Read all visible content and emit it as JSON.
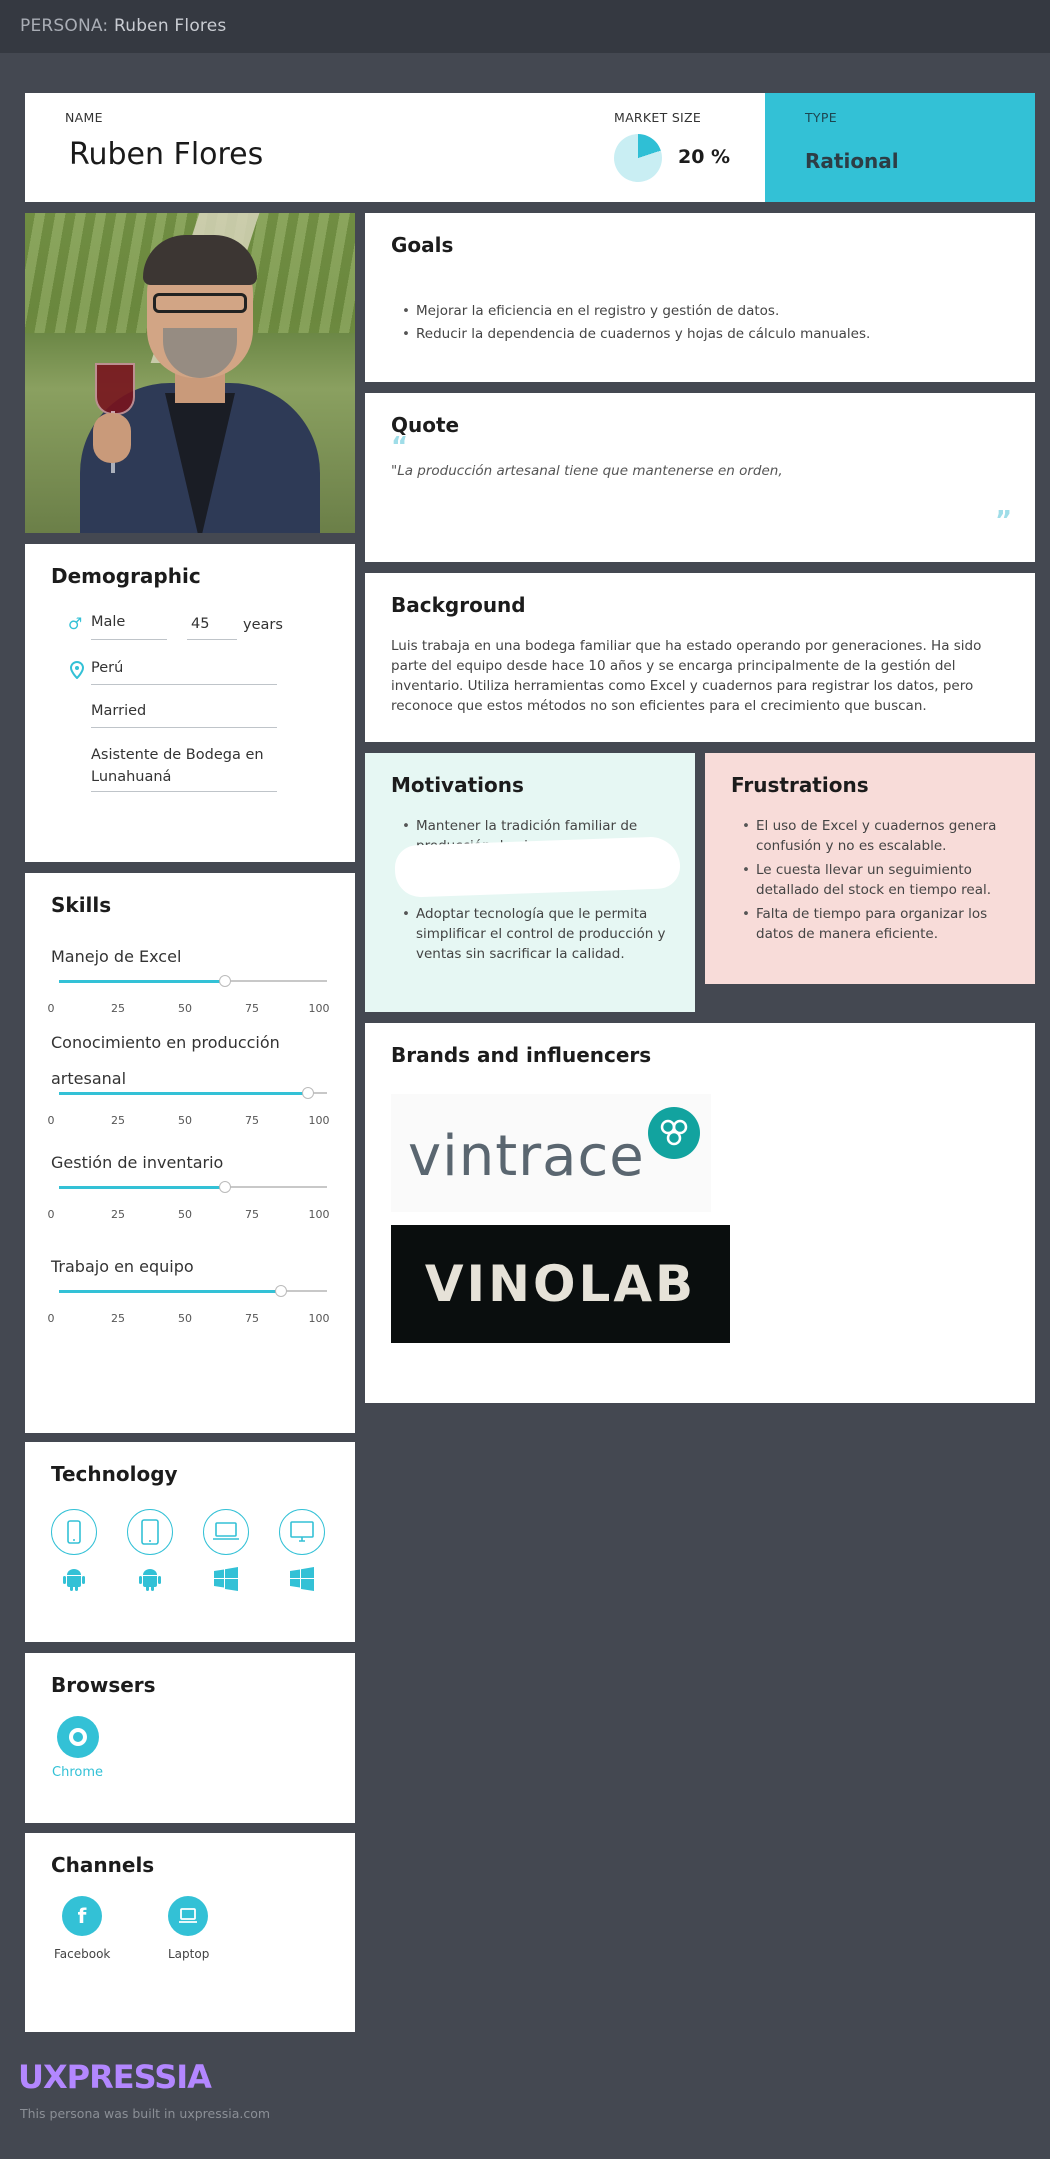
{
  "topbar": {
    "label": "PERSONA:",
    "name": "Ruben Flores"
  },
  "header": {
    "name_label": "NAME",
    "name": "Ruben Flores",
    "market_label": "MARKET SIZE",
    "market_value": "20 %",
    "market_fraction": 0.2,
    "type_label": "TYPE",
    "type_value": "Rational"
  },
  "photo": {
    "icon": "persona-photo"
  },
  "demographic": {
    "title": "Demographic",
    "gender": "Male",
    "age": "45",
    "age_unit": "years",
    "location": "Perú",
    "status": "Married",
    "occupation": "Asistente de Bodega en Lunahuaná"
  },
  "skills": {
    "title": "Skills",
    "ticks": [
      "0",
      "25",
      "50",
      "75",
      "100"
    ],
    "items": [
      {
        "label": "Manejo de Excel",
        "value": 62
      },
      {
        "label": "Conocimiento en producción artesanal",
        "value": 93
      },
      {
        "label": "Gestión de inventario",
        "value": 62
      },
      {
        "label": "Trabajo en equipo",
        "value": 83
      }
    ]
  },
  "technology": {
    "title": "Technology",
    "devices": [
      "phone-icon",
      "tablet-icon",
      "laptop-icon",
      "desktop-icon"
    ],
    "os": [
      "android-icon",
      "android-icon",
      "windows-icon",
      "windows-icon"
    ]
  },
  "browsers": {
    "title": "Browsers",
    "items": [
      {
        "label": "Chrome",
        "icon": "chrome-icon"
      }
    ]
  },
  "channels": {
    "title": "Channels",
    "items": [
      {
        "label": "Facebook",
        "icon": "facebook-icon"
      },
      {
        "label": "Laptop",
        "icon": "laptop-icon"
      }
    ]
  },
  "goals": {
    "title": "Goals",
    "items": [
      "Mejorar la eficiencia en el registro y gestión de datos.",
      "Reducir la dependencia de cuadernos y hojas de cálculo manuales."
    ]
  },
  "quote": {
    "title": "Quote",
    "text": "\"La producción artesanal tiene que mantenerse en orden,"
  },
  "background": {
    "title": "Background",
    "text": "Luis trabaja en una bodega familiar que ha estado operando por generaciones. Ha sido parte del equipo desde hace 10 años y se encarga principalmente de la gestión del inventario. Utiliza herramientas como Excel y cuadernos para registrar los datos, pero reconoce que estos métodos no son eficientes para el crecimiento que buscan."
  },
  "motivations": {
    "title": "Motivations",
    "items": [
      "Mantener la tradición familiar de producción de vinos.",
      "Adoptar tecnología que le permita simplificar el control de producción y ventas sin sacrificar la calidad."
    ]
  },
  "frustrations": {
    "title": "Frustrations",
    "items": [
      "El uso de Excel y cuadernos genera confusión y no es escalable.",
      "Le cuesta llevar un seguimiento detallado del stock en tiempo real.",
      "Falta de tiempo para organizar los datos de manera eficiente."
    ]
  },
  "brands": {
    "title": "Brands and influencers",
    "items": [
      "vintrace",
      "VINOLAB"
    ]
  },
  "footer": {
    "logo": "UXPRESSIA",
    "text": "This persona was built in uxpressia.com"
  },
  "colors": {
    "accent": "#33c1d6",
    "bg": "#444851",
    "topbar": "#353941",
    "motivations": "#e6f7f3",
    "frustrations": "#f8dcd9",
    "footer_logo": "#b387ff"
  }
}
